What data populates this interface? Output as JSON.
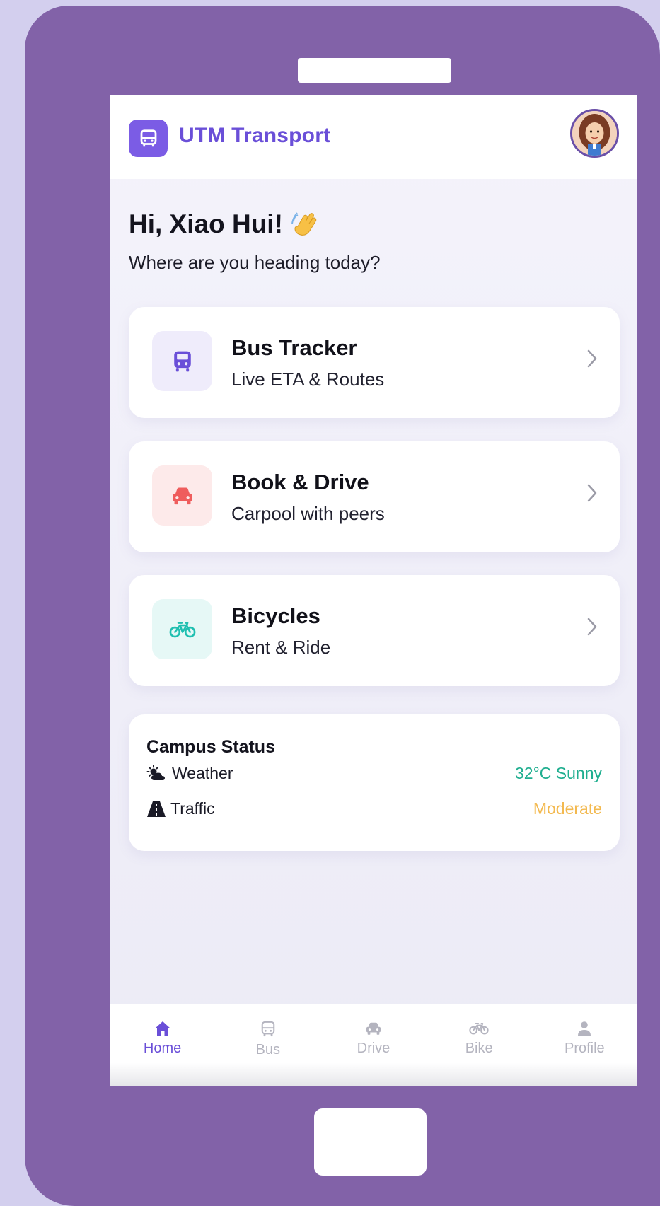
{
  "app": {
    "title": "UTM Transport"
  },
  "greeting": {
    "title": "Hi, Xiao Hui!",
    "subtitle": "Where are you heading today?"
  },
  "cards": [
    {
      "title": "Bus Tracker",
      "desc": "Live ETA & Routes",
      "icon": "bus-icon",
      "accent": "#6a4fd8",
      "bg": "#efecfb"
    },
    {
      "title": "Book & Drive",
      "desc": "Carpool with peers",
      "icon": "car-icon",
      "accent": "#ef5d5d",
      "bg": "#fdeaea"
    },
    {
      "title": "Bicycles",
      "desc": "Rent & Ride",
      "icon": "bicycle-icon",
      "accent": "#1fbfb0",
      "bg": "#e6f8f6"
    }
  ],
  "status": {
    "title": "Campus Status",
    "weather_label": "Weather",
    "weather_value": "32°C Sunny",
    "weather_color": "#1fae8f",
    "traffic_label": "Traffic",
    "traffic_value": "Moderate",
    "traffic_color": "#f3b94f"
  },
  "nav": [
    {
      "label": "Home",
      "icon": "home-icon",
      "active": true
    },
    {
      "label": "Bus",
      "icon": "bus-icon",
      "active": false
    },
    {
      "label": "Drive",
      "icon": "car-icon",
      "active": false
    },
    {
      "label": "Bike",
      "icon": "bicycle-icon",
      "active": false
    },
    {
      "label": "Profile",
      "icon": "user-icon",
      "active": false
    }
  ],
  "colors": {
    "brand": "#6a4fd8",
    "frame": "#8262a8",
    "background": "#d3cfee"
  }
}
